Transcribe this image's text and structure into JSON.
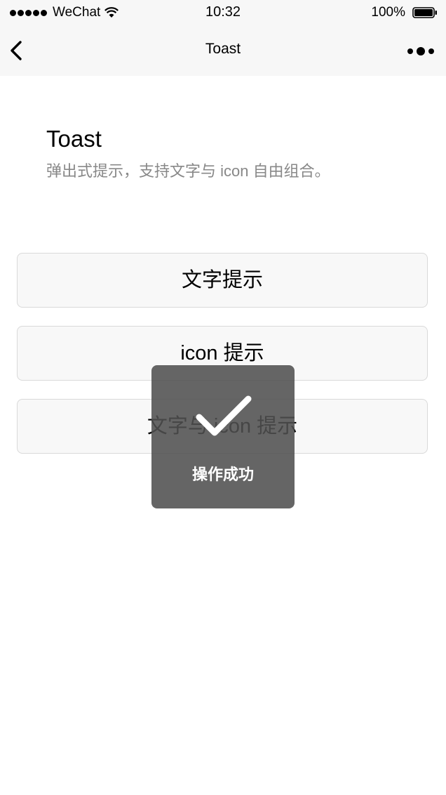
{
  "status_bar": {
    "carrier": "WeChat",
    "time": "10:32",
    "battery": "100%"
  },
  "nav": {
    "title": "Toast"
  },
  "header": {
    "title": "Toast",
    "description": "弹出式提示，支持文字与 icon 自由组合。"
  },
  "buttons": [
    {
      "label": "文字提示"
    },
    {
      "label": "icon 提示"
    },
    {
      "label": "文字与 icon 提示"
    }
  ],
  "toast": {
    "icon": "checkmark-icon",
    "text": "操作成功"
  }
}
